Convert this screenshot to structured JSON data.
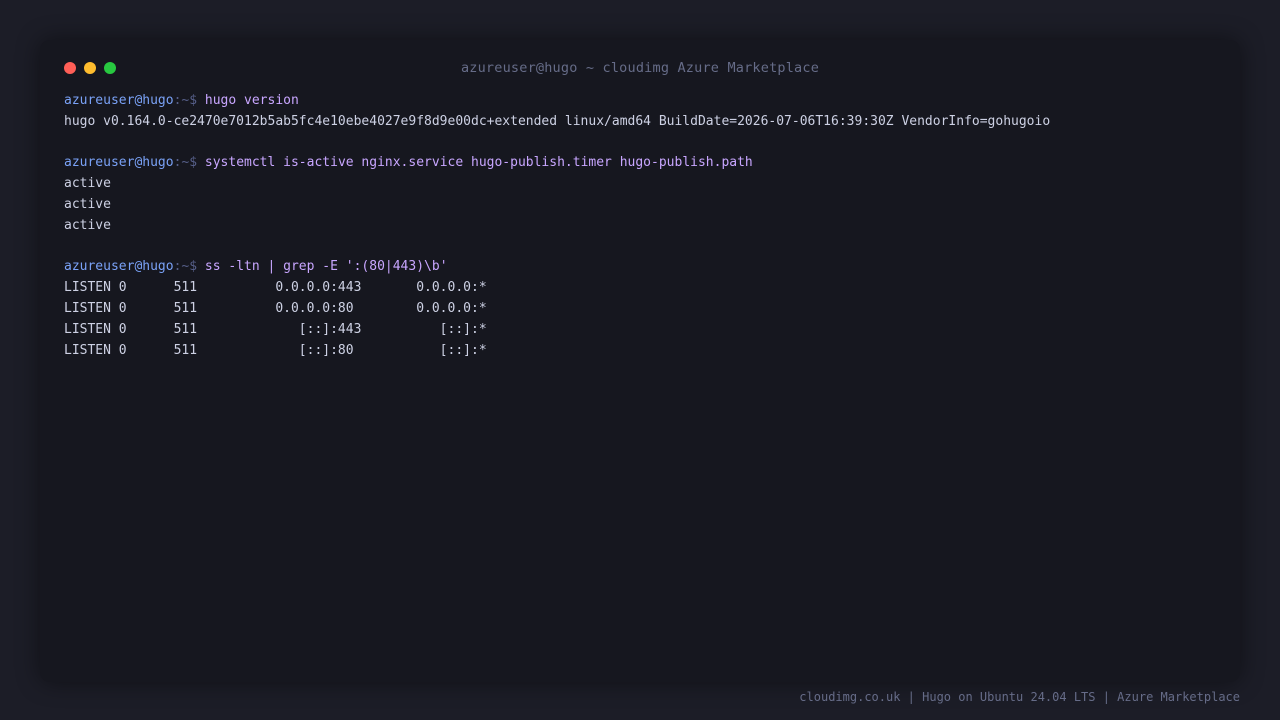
{
  "window": {
    "title": "azureuser@hugo ~ cloudimg Azure Marketplace",
    "controls": {
      "close_color": "#ff5f57",
      "minimize_color": "#febc2e",
      "maximize_color": "#28c840"
    }
  },
  "terminal": {
    "prompt_user": "azureuser@hugo",
    "prompt_suffix": ":~$",
    "blocks": [
      {
        "command": "hugo version",
        "output": [
          "hugo v0.164.0-ce2470e7012b5ab5fc4e10ebe4027e9f8d9e00dc+extended linux/amd64 BuildDate=2026-07-06T16:39:30Z VendorInfo=gohugoio"
        ]
      },
      {
        "command": "systemctl is-active nginx.service hugo-publish.timer hugo-publish.path",
        "output": [
          "active",
          "active",
          "active"
        ]
      },
      {
        "command": "ss -ltn | grep -E ':(80|443)\\b'",
        "output": [
          "LISTEN 0      511          0.0.0.0:443       0.0.0.0:*",
          "LISTEN 0      511          0.0.0.0:80        0.0.0.0:*",
          "LISTEN 0      511             [::]:443          [::]:*",
          "LISTEN 0      511             [::]:80           [::]:*"
        ]
      }
    ]
  },
  "footer": {
    "text": "cloudimg.co.uk | Hugo on Ubuntu 24.04 LTS | Azure Marketplace"
  },
  "colors": {
    "prompt_user": "#7aa2f7",
    "command": "#c8a6ff",
    "output": "#cdd1e4",
    "background": "#16171f"
  }
}
